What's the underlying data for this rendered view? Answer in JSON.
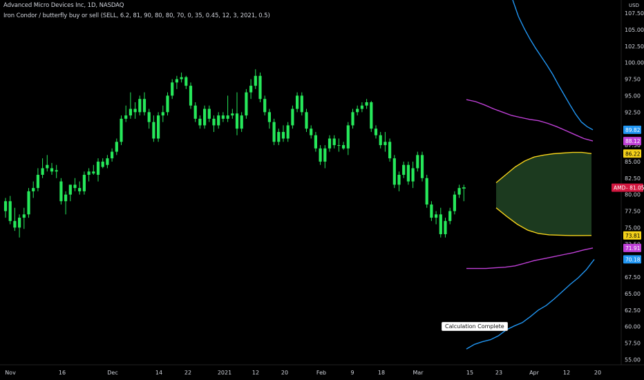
{
  "header": {
    "symbol_line": "Advanced Micro Devices Inc, 1D, NASDAQ",
    "indicator_line": "Iron Condor / butterfly buy or sell (SELL, 6.2, 81, 90, 80, 80, 70, 0, 35, 0.45, 12, 3, 2021, 0.5)"
  },
  "tooltip": "Calculation Complete",
  "chart_data": {
    "type": "candlestick",
    "currency": "USD",
    "ylim": [
      54.2,
      109.5
    ],
    "y_ticks": [
      "107.50",
      "105.00",
      "102.50",
      "100.00",
      "97.50",
      "95.00",
      "92.50",
      "90.00",
      "87.50",
      "85.00",
      "82.50",
      "80.00",
      "77.50",
      "75.00",
      "72.50",
      "70.00",
      "67.50",
      "65.00",
      "62.50",
      "60.00",
      "57.50",
      "55.00"
    ],
    "x_ticks": [
      "Nov",
      "16",
      "Dec",
      "14",
      "22",
      "2021",
      "12",
      "20",
      "Feb",
      "9",
      "18",
      "Mar",
      "15",
      "23",
      "Apr",
      "12",
      "20"
    ],
    "price_labels": [
      {
        "text": "AMD",
        "value": 81.05,
        "color": "#d1173f"
      },
      {
        "text": "89.82",
        "value": 89.82,
        "color": "#2196f3"
      },
      {
        "text": "88.12",
        "value": 88.12,
        "color": "#c040d8"
      },
      {
        "text": "86.22",
        "value": 86.22,
        "color": "#f5d21a"
      },
      {
        "text": "73.81",
        "value": 73.81,
        "color": "#f5d21a"
      },
      {
        "text": "71.91",
        "value": 71.91,
        "color": "#c040d8"
      },
      {
        "text": "70.18",
        "value": 70.18,
        "color": "#2196f3"
      }
    ],
    "ohlc": [
      [
        77.5,
        79.5,
        76.5,
        79.0
      ],
      [
        79.0,
        79.8,
        75.5,
        76.0
      ],
      [
        76.0,
        78.0,
        74.5,
        75.0
      ],
      [
        75.0,
        77.0,
        73.5,
        76.5
      ],
      [
        76.5,
        78.0,
        74.8,
        77.0
      ],
      [
        77.0,
        81.0,
        76.5,
        80.5
      ],
      [
        80.5,
        82.0,
        79.5,
        81.0
      ],
      [
        81.0,
        84.0,
        80.5,
        83.0
      ],
      [
        83.0,
        85.5,
        82.5,
        84.0
      ],
      [
        84.0,
        86.0,
        83.5,
        84.5
      ],
      [
        84.0,
        84.8,
        83.0,
        83.5
      ],
      [
        83.5,
        84.5,
        82.5,
        83.7
      ],
      [
        82.0,
        82.5,
        78.5,
        79.0
      ],
      [
        79.0,
        80.5,
        77.0,
        80.0
      ],
      [
        80.0,
        81.5,
        79.0,
        81.5
      ],
      [
        81.5,
        82.5,
        80.5,
        81.0
      ],
      [
        81.0,
        82.0,
        80.0,
        80.5
      ],
      [
        80.5,
        83.5,
        80.0,
        83.0
      ],
      [
        83.0,
        84.0,
        82.0,
        83.5
      ],
      [
        83.5,
        84.5,
        83.0,
        83.2
      ],
      [
        83.0,
        85.5,
        82.0,
        85.0
      ],
      [
        85.0,
        85.5,
        84.0,
        84.2
      ],
      [
        84.5,
        86.0,
        84.0,
        85.5
      ],
      [
        85.5,
        87.0,
        85.0,
        86.5
      ],
      [
        86.5,
        88.5,
        86.0,
        88.0
      ],
      [
        88.0,
        92.0,
        87.5,
        91.5
      ],
      [
        91.5,
        93.5,
        91.0,
        92.0
      ],
      [
        92.0,
        95.5,
        91.5,
        93.0
      ],
      [
        93.0,
        94.0,
        91.5,
        92.5
      ],
      [
        92.5,
        95.0,
        92.0,
        94.5
      ],
      [
        94.5,
        95.5,
        92.0,
        92.5
      ],
      [
        92.5,
        93.0,
        90.0,
        91.0
      ],
      [
        91.0,
        92.0,
        88.0,
        88.5
      ],
      [
        88.5,
        92.5,
        88.0,
        92.0
      ],
      [
        92.0,
        93.5,
        91.0,
        92.5
      ],
      [
        92.5,
        95.5,
        92.0,
        95.0
      ],
      [
        95.0,
        97.5,
        94.5,
        97.0
      ],
      [
        97.0,
        98.0,
        96.0,
        97.5
      ],
      [
        97.5,
        98.5,
        97.0,
        97.8
      ],
      [
        97.8,
        98.0,
        96.0,
        96.5
      ],
      [
        96.5,
        97.0,
        93.0,
        93.5
      ],
      [
        93.5,
        94.0,
        91.0,
        91.5
      ],
      [
        91.5,
        92.0,
        90.0,
        90.5
      ],
      [
        90.5,
        93.5,
        90.0,
        93.0
      ],
      [
        93.0,
        93.5,
        91.0,
        91.5
      ],
      [
        91.5,
        92.0,
        89.5,
        90.5
      ],
      [
        90.5,
        92.5,
        90.0,
        92.0
      ],
      [
        92.0,
        92.5,
        91.0,
        91.5
      ],
      [
        91.5,
        95.0,
        91.0,
        92.0
      ],
      [
        92.0,
        93.0,
        91.5,
        92.3
      ],
      [
        92.3,
        95.5,
        89.0,
        90.0
      ],
      [
        90.0,
        92.5,
        89.5,
        92.0
      ],
      [
        92.0,
        96.0,
        91.5,
        95.5
      ],
      [
        95.5,
        97.5,
        94.5,
        96.5
      ],
      [
        96.5,
        99.0,
        96.0,
        98.0
      ],
      [
        98.0,
        98.5,
        94.0,
        94.5
      ],
      [
        94.5,
        95.0,
        92.0,
        92.5
      ],
      [
        92.5,
        93.0,
        90.0,
        91.0
      ],
      [
        91.0,
        91.5,
        87.5,
        88.0
      ],
      [
        88.0,
        90.0,
        87.5,
        89.5
      ],
      [
        89.5,
        90.5,
        88.0,
        88.5
      ],
      [
        88.5,
        91.0,
        88.0,
        90.5
      ],
      [
        90.5,
        93.5,
        90.0,
        93.0
      ],
      [
        93.0,
        95.5,
        92.5,
        95.0
      ],
      [
        95.0,
        95.5,
        92.0,
        92.5
      ],
      [
        92.5,
        93.0,
        89.5,
        90.0
      ],
      [
        90.0,
        90.5,
        88.5,
        89.0
      ],
      [
        89.0,
        89.5,
        86.5,
        87.0
      ],
      [
        87.0,
        87.5,
        84.5,
        85.0
      ],
      [
        85.0,
        87.5,
        84.0,
        87.0
      ],
      [
        87.0,
        89.0,
        86.5,
        88.5
      ],
      [
        88.5,
        89.0,
        87.0,
        87.5
      ],
      [
        87.5,
        88.5,
        86.5,
        87.5
      ],
      [
        87.5,
        88.0,
        86.8,
        87.0
      ],
      [
        87.0,
        91.0,
        86.0,
        90.5
      ],
      [
        90.5,
        93.0,
        90.0,
        92.5
      ],
      [
        92.5,
        93.5,
        92.0,
        93.0
      ],
      [
        93.0,
        94.0,
        92.5,
        93.5
      ],
      [
        93.5,
        94.5,
        93.0,
        94.0
      ],
      [
        94.0,
        94.2,
        89.5,
        90.0
      ],
      [
        90.0,
        90.5,
        88.5,
        89.0
      ],
      [
        89.0,
        89.5,
        87.0,
        87.5
      ],
      [
        87.5,
        89.5,
        86.5,
        88.0
      ],
      [
        88.0,
        88.5,
        85.0,
        85.5
      ],
      [
        85.5,
        86.0,
        81.0,
        81.5
      ],
      [
        81.5,
        83.5,
        80.5,
        83.0
      ],
      [
        83.0,
        85.0,
        82.5,
        84.5
      ],
      [
        84.5,
        85.0,
        81.5,
        82.0
      ],
      [
        82.0,
        85.0,
        81.0,
        84.0
      ],
      [
        84.0,
        86.5,
        83.5,
        86.0
      ],
      [
        86.0,
        86.5,
        82.0,
        82.5
      ],
      [
        82.5,
        83.0,
        78.0,
        78.5
      ],
      [
        78.5,
        79.0,
        76.0,
        76.5
      ],
      [
        76.5,
        77.5,
        75.5,
        77.0
      ],
      [
        77.0,
        78.0,
        73.5,
        74.0
      ],
      [
        74.0,
        76.5,
        73.5,
        76.0
      ],
      [
        76.0,
        78.0,
        75.5,
        77.5
      ],
      [
        77.5,
        80.5,
        77.0,
        80.0
      ],
      [
        80.0,
        81.5,
        79.5,
        81.0
      ],
      [
        81.0,
        81.5,
        79.0,
        81.05
      ]
    ],
    "outer_upper": [
      89.82,
      90.3,
      91.0,
      92.2,
      93.6,
      95.1,
      96.6,
      98.2,
      99.6,
      100.9,
      102.2,
      103.6,
      105.2,
      107.0,
      109.5
    ],
    "inner_upper": [
      94.4,
      94.1,
      93.6,
      93.0,
      92.5,
      92.0,
      91.7,
      91.4,
      91.2,
      90.8,
      90.3,
      89.7,
      89.1,
      88.5,
      88.12
    ],
    "wing_upper": [
      81.8,
      83.0,
      84.2,
      85.1,
      85.7,
      86.0,
      86.2,
      86.3,
      86.4,
      86.4,
      86.22
    ],
    "wing_lower": [
      78.0,
      76.7,
      75.5,
      74.6,
      74.1,
      73.9,
      73.85,
      73.8,
      73.8,
      73.81
    ],
    "inner_lower": [
      68.8,
      68.8,
      68.8,
      68.9,
      69.0,
      69.2,
      69.6,
      70.0,
      70.3,
      70.6,
      70.9,
      71.2,
      71.6,
      71.91
    ],
    "outer_lower": [
      56.6,
      57.3,
      57.7,
      58.0,
      58.6,
      59.5,
      60.1,
      60.6,
      61.5,
      62.5,
      63.2,
      64.2,
      65.3,
      66.4,
      67.4,
      68.6,
      70.18
    ],
    "colors": {
      "up": "#26e85a",
      "down": "#26e85a",
      "outer": "#2196f3",
      "inner": "#c040d8",
      "wing": "#f5d21a",
      "wing_fill": "#1c3a1f"
    }
  }
}
